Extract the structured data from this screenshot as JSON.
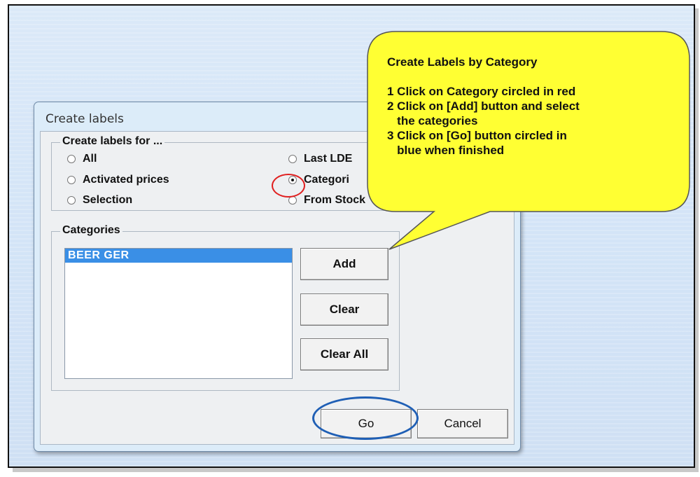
{
  "dialog": {
    "title": "Create labels",
    "group_create": {
      "legend": "Create labels for ...",
      "options": [
        {
          "label": "All",
          "checked": false
        },
        {
          "label": "Activated prices",
          "checked": false
        },
        {
          "label": "Selection",
          "checked": false
        },
        {
          "label": "Last LDE",
          "checked": false
        },
        {
          "label": "Categori",
          "checked": true
        },
        {
          "label": "From Stock",
          "checked": false
        }
      ]
    },
    "group_categories": {
      "legend": "Categories",
      "items": [
        "BEER GER"
      ]
    },
    "buttons": {
      "add": "Add",
      "clear": "Clear",
      "clear_all": "Clear All",
      "go": "Go",
      "cancel": "Cancel"
    }
  },
  "callout": {
    "title": "Create Labels by Category",
    "steps": [
      "1 Click on Category circled in red",
      "2 Click on [Add] button and select\n   the categories",
      "3 Click on [Go] button circled in\n   blue when finished"
    ],
    "fill_color": "#ffff33",
    "stroke_color": "#555555"
  },
  "annotations": {
    "red_circle_color": "#e02020",
    "blue_ellipse_color": "#1f5fb5"
  }
}
